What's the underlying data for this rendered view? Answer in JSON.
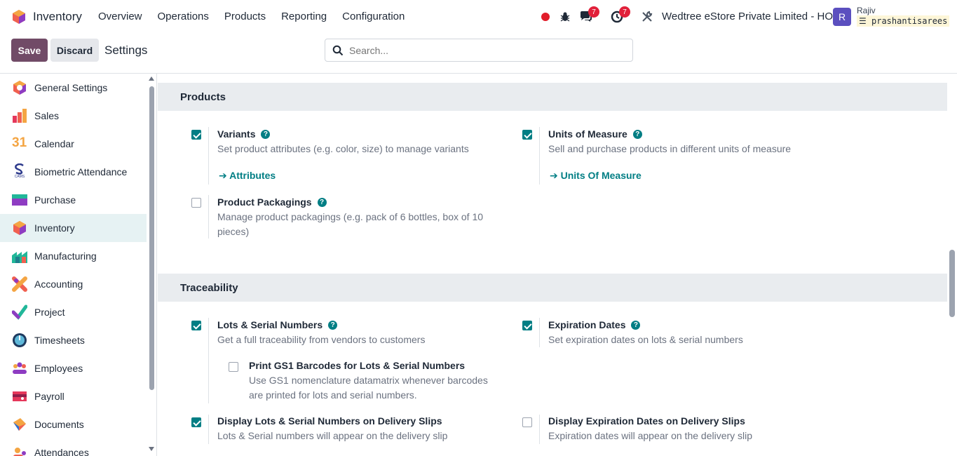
{
  "navbar": {
    "app_name": "Inventory",
    "menu": [
      "Overview",
      "Operations",
      "Products",
      "Reporting",
      "Configuration"
    ],
    "messages_count": "7",
    "activities_count": "7",
    "company": "Wedtree eStore Private Limited - HO",
    "avatar_letter": "R",
    "user_name": "Rajiv",
    "database": "prashantisarees"
  },
  "control_panel": {
    "save_label": "Save",
    "discard_label": "Discard",
    "title": "Settings",
    "search_placeholder": "Search..."
  },
  "sidebar": {
    "items": [
      {
        "label": "General Settings",
        "icon": "general-settings-icon"
      },
      {
        "label": "Sales",
        "icon": "sales-icon"
      },
      {
        "label": "Calendar",
        "icon": "calendar-icon"
      },
      {
        "label": "Biometric Attendance",
        "icon": "biometric-icon"
      },
      {
        "label": "Purchase",
        "icon": "purchase-icon"
      },
      {
        "label": "Inventory",
        "icon": "inventory-icon",
        "active": true
      },
      {
        "label": "Manufacturing",
        "icon": "manufacturing-icon"
      },
      {
        "label": "Accounting",
        "icon": "accounting-icon"
      },
      {
        "label": "Project",
        "icon": "project-icon"
      },
      {
        "label": "Timesheets",
        "icon": "timesheets-icon"
      },
      {
        "label": "Employees",
        "icon": "employees-icon"
      },
      {
        "label": "Payroll",
        "icon": "payroll-icon"
      },
      {
        "label": "Documents",
        "icon": "documents-icon"
      },
      {
        "label": "Attendances",
        "icon": "attendances-icon"
      }
    ],
    "calendar_icon_text": "31",
    "biometric_icon_text": "CAMS"
  },
  "sections": {
    "products": {
      "title": "Products",
      "variants": {
        "title": "Variants",
        "desc": "Set product attributes (e.g. color, size) to manage variants",
        "link": "Attributes",
        "checked": true
      },
      "uom": {
        "title": "Units of Measure",
        "desc": "Sell and purchase products in different units of measure",
        "link": "Units Of Measure",
        "checked": true
      },
      "packagings": {
        "title": "Product Packagings",
        "desc_line1": "Manage product packagings (e.g. pack of 6 bottles, box of 10",
        "desc_line2": "pieces)",
        "checked": false
      }
    },
    "traceability": {
      "title": "Traceability",
      "lots": {
        "title": "Lots & Serial Numbers",
        "desc": "Get a full traceability from vendors to customers",
        "checked": true
      },
      "gs1": {
        "title": "Print GS1 Barcodes for Lots & Serial Numbers",
        "desc_line1": "Use GS1 nomenclature datamatrix whenever barcodes",
        "desc_line2": "are printed for lots and serial numbers.",
        "checked": false
      },
      "expiration": {
        "title": "Expiration Dates",
        "desc": "Set expiration dates on lots & serial numbers",
        "checked": true
      },
      "display_lots": {
        "title": "Display Lots & Serial Numbers on Delivery Slips",
        "desc": "Lots & Serial numbers will appear on the delivery slip",
        "checked": true
      },
      "display_exp": {
        "title": "Display Expiration Dates on Delivery Slips",
        "desc": "Expiration dates will appear on the delivery slip",
        "checked": false
      }
    }
  },
  "help_glyph": "?",
  "link_arrow": "➔",
  "colors": {
    "brand": "#714b67",
    "accent": "#017e84",
    "badge": "#e1203a"
  }
}
